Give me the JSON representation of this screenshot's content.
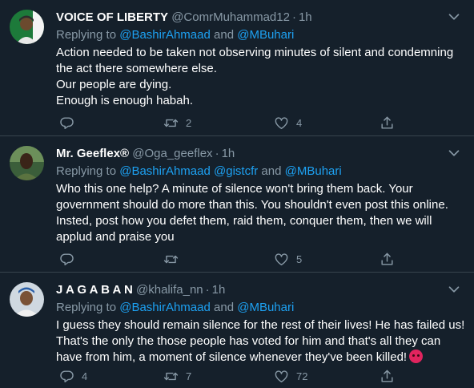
{
  "tweets": [
    {
      "name": "VOICE OF LIBERTY",
      "handle": "@ComrMuhammad12",
      "time": "1h",
      "replying_prefix": "Replying to",
      "mentions": [
        "@BashirAhmaad",
        "@MBuhari"
      ],
      "conjunctions": [
        "and"
      ],
      "body": [
        "Action needed to be taken not observing minutes of silent and condemning the act there somewhere else.",
        "Our people are dying.",
        "Enough is enough habah."
      ],
      "counts": {
        "reply": "",
        "retweet": "2",
        "like": "4"
      }
    },
    {
      "name": "Mr. Geeflex®",
      "handle": "@Oga_geeflex",
      "time": "1h",
      "replying_prefix": "Replying to",
      "mentions": [
        "@BashirAhmaad",
        "@gistcfr",
        "@MBuhari"
      ],
      "conjunctions": [
        "and"
      ],
      "body": [
        "Who this one help? A minute of silence won't bring them back. Your government should do more than this. You shouldn't even post this online. Insted, post how you defet them, raid them, conquer them, then we will applud and praise you"
      ],
      "counts": {
        "reply": "",
        "retweet": "",
        "like": "5"
      }
    },
    {
      "name": "J A G A B A N",
      "handle": "@khalifa_nn",
      "time": "1h",
      "replying_prefix": "Replying to",
      "mentions": [
        "@BashirAhmaad",
        "@MBuhari"
      ],
      "conjunctions": [
        "and"
      ],
      "body": [
        "I guess they should remain silence for the rest of their lives! He has failed us! That's the only the those people has voted for him and that's all they can have from him, a moment of silence whenever they've been killed!"
      ],
      "counts": {
        "reply": "4",
        "retweet": "7",
        "like": "72"
      }
    }
  ],
  "icons": {
    "reply": "reply-icon",
    "retweet": "retweet-icon",
    "like": "like-icon",
    "share": "share-icon",
    "more": "chevron-down-icon",
    "emoji": "angry-face-emoji"
  },
  "colors": {
    "background": "#15202b",
    "divider": "#38444d",
    "secondary_text": "#8899a6",
    "link": "#1da1f2"
  }
}
